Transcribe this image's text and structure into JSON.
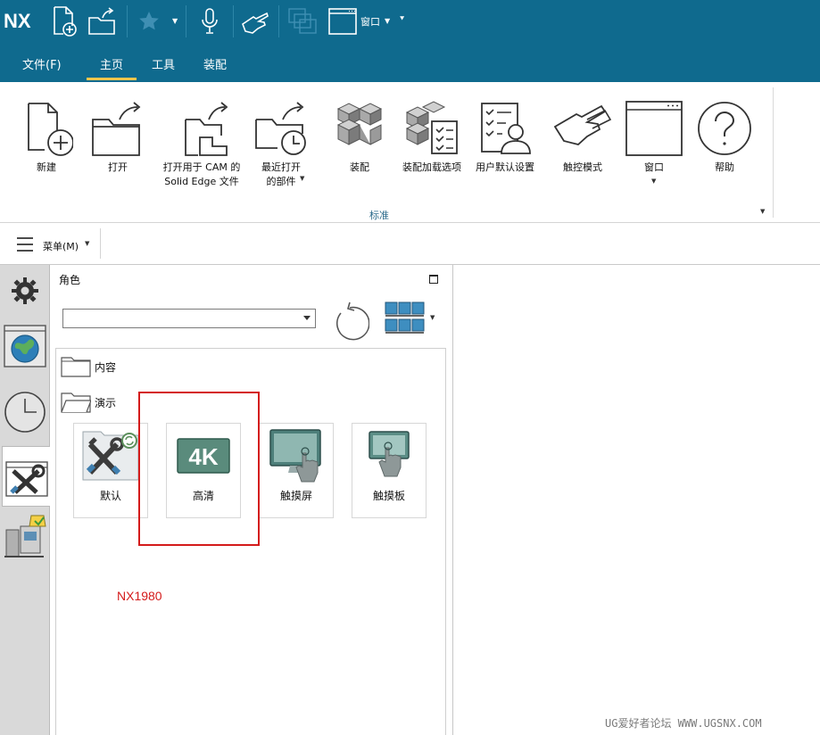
{
  "app": {
    "logo": "NX"
  },
  "quick_access": {
    "window_label": "窗口",
    "icons": [
      "new-file-icon",
      "open-folder-icon",
      "favorite-star-icon",
      "microphone-icon",
      "touch-hand-icon",
      "window-stack-icon",
      "window-icon"
    ]
  },
  "tabs": [
    {
      "label": "文件(F)"
    },
    {
      "label": "主页",
      "active": true
    },
    {
      "label": "工具"
    },
    {
      "label": "装配"
    }
  ],
  "ribbon": {
    "group_label": "标准",
    "buttons": [
      {
        "label": "新建",
        "icon": "new-file-icon"
      },
      {
        "label": "打开",
        "icon": "open-folder-icon"
      },
      {
        "label": "打开用于 CAM 的\nSolid Edge 文件",
        "icon": "open-solid-edge-icon"
      },
      {
        "label": "最近打开\n的部件",
        "icon": "recent-clock-icon",
        "dropdown": true
      },
      {
        "label": "装配",
        "icon": "assembly-cubes-icon"
      },
      {
        "label": "装配加载选项",
        "icon": "assembly-load-options-icon"
      },
      {
        "label": "用户默认设置",
        "icon": "user-defaults-icon"
      },
      {
        "label": "触控模式",
        "icon": "touch-mode-icon"
      },
      {
        "label": "窗口",
        "icon": "window-icon",
        "dropdown": true
      },
      {
        "label": "帮助",
        "icon": "help-icon"
      }
    ]
  },
  "menu": {
    "label": "菜单(M)"
  },
  "role_panel": {
    "title": "角色",
    "select_value": "",
    "folders": [
      {
        "label": "内容"
      },
      {
        "label": "演示"
      }
    ],
    "tiles": [
      {
        "label": "默认",
        "icon": "tools-default-icon"
      },
      {
        "label": "高清",
        "icon": "4k-icon",
        "badge": "4K"
      },
      {
        "label": "触摸屏",
        "icon": "touch-screen-icon"
      },
      {
        "label": "触摸板",
        "icon": "touch-pad-icon"
      }
    ]
  },
  "annotation": {
    "version_note": "NX1980"
  },
  "watermark": "UG爱好者论坛 WWW.UGSNX.COM",
  "colors": {
    "titlebar": "#0f6a8e",
    "tab_underline": "#f0c64c",
    "highlight": "#d41b1b"
  }
}
